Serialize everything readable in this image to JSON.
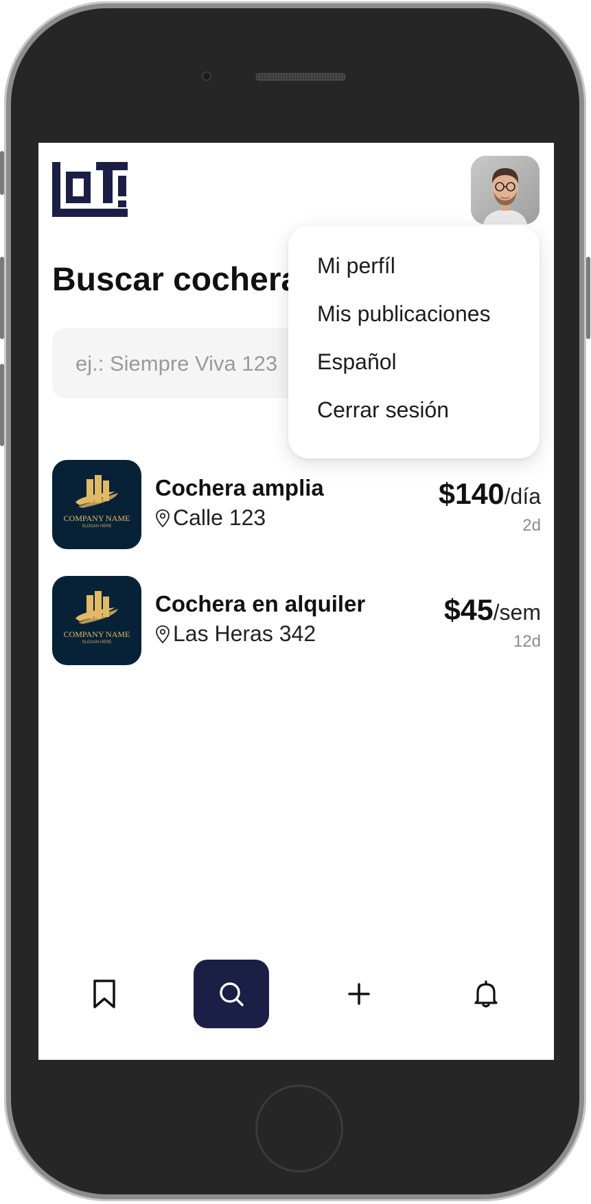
{
  "header": {
    "logo": "LOTI"
  },
  "page": {
    "title": "Buscar cocheras"
  },
  "search": {
    "placeholder": "ej.: Siempre Viva 123"
  },
  "listings": [
    {
      "title": "Cochera amplia",
      "address": "Calle 123",
      "price": "$140",
      "unit": "/día",
      "age": "2d",
      "thumbnail": {
        "company": "COMPANY NAME",
        "slogan": "SLOGAN HERE"
      }
    },
    {
      "title": "Cochera en alquiler",
      "address": "Las Heras 342",
      "price": "$45",
      "unit": "/sem",
      "age": "12d",
      "thumbnail": {
        "company": "COMPANY NAME",
        "slogan": "SLOGAN HERE"
      }
    }
  ],
  "profile_menu": {
    "items": [
      "Mi perfíl",
      "Mis publicaciones",
      "Español",
      "Cerrar sesión"
    ]
  },
  "bottom_nav": {
    "items": [
      {
        "icon": "bookmark-icon",
        "active": false
      },
      {
        "icon": "search-icon",
        "active": true
      },
      {
        "icon": "plus-icon",
        "active": false
      },
      {
        "icon": "bell-icon",
        "active": false
      }
    ]
  },
  "colors": {
    "brand_navy": "#1b1f45",
    "thumb_bg": "#072237",
    "thumb_gold": "#e2b964",
    "search_bg": "#f5f5f5"
  }
}
